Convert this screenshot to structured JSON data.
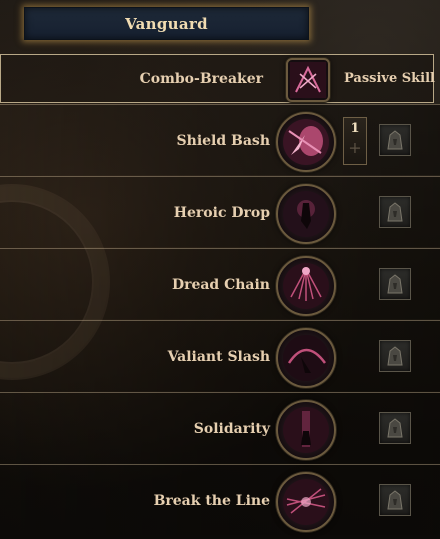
{
  "header": {
    "title": "Vanguard"
  },
  "passive": {
    "name": "Combo-Breaker",
    "label": "Passive Skill",
    "icon": "combo-breaker-icon"
  },
  "skills": [
    {
      "name": "Shield Bash",
      "icon": "shield-bash-icon",
      "rank": "1",
      "rank_plus": "+",
      "slot_icon": "locked-slot-icon"
    },
    {
      "name": "Heroic Drop",
      "icon": "heroic-drop-icon",
      "slot_icon": "locked-slot-icon"
    },
    {
      "name": "Dread Chain",
      "icon": "dread-chain-icon",
      "slot_icon": "locked-slot-icon"
    },
    {
      "name": "Valiant Slash",
      "icon": "valiant-slash-icon",
      "slot_icon": "locked-slot-icon"
    },
    {
      "name": "Solidarity",
      "icon": "solidarity-icon",
      "slot_icon": "locked-slot-icon"
    },
    {
      "name": "Break the Line",
      "icon": "break-the-line-icon",
      "slot_icon": "locked-slot-icon"
    }
  ],
  "colors": {
    "title_bg": "#1e2938",
    "title_glow": "#cda050",
    "text": "#e6cfb0",
    "frame_gold": "#6b5a3e",
    "skill_magenta": "#c0507a"
  }
}
